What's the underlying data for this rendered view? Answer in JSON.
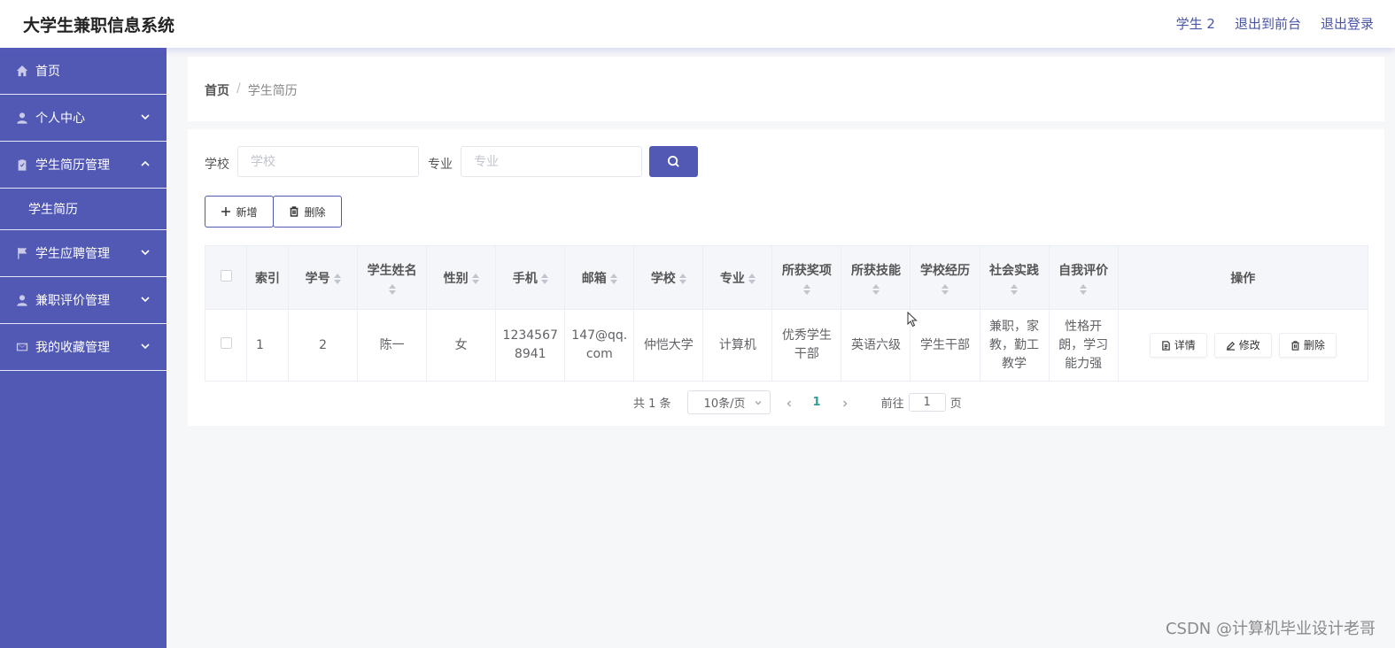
{
  "app": {
    "title": "大学生兼职信息系统"
  },
  "topbar": {
    "user": "学生 2",
    "to_front": "退出到前台",
    "logout": "退出登录"
  },
  "sidebar": {
    "items": [
      {
        "label": "首页",
        "icon": "home-icon"
      },
      {
        "label": "个人中心",
        "icon": "user-icon"
      },
      {
        "label": "学生简历管理",
        "icon": "clipboard-icon",
        "expanded": true,
        "sub": "学生简历"
      },
      {
        "label": "学生应聘管理",
        "icon": "flag-icon"
      },
      {
        "label": "兼职评价管理",
        "icon": "user-icon"
      },
      {
        "label": "我的收藏管理",
        "icon": "mail-icon"
      }
    ]
  },
  "breadcrumb": {
    "home": "首页",
    "sep": "/",
    "current": "学生简历"
  },
  "filters": {
    "school_label": "学校",
    "school_placeholder": "学校",
    "major_label": "专业",
    "major_placeholder": "专业"
  },
  "actions": {
    "add": "新增",
    "delete": "删除"
  },
  "table": {
    "headers": [
      "索引",
      "学号",
      "学生姓名",
      "性别",
      "手机",
      "邮箱",
      "学校",
      "专业",
      "所获奖项",
      "所获技能",
      "学校经历",
      "社会实践",
      "自我评价",
      "操作"
    ],
    "rows": [
      {
        "index": "1",
        "student_no": "2",
        "name": "陈一",
        "gender": "女",
        "phone": "12345678941",
        "email": "147@qq.com",
        "school": "仲恺大学",
        "major": "计算机",
        "awards": "优秀学生干部",
        "skills": "英语六级",
        "experience": "学生干部",
        "practice": "兼职，家教，勤工教学",
        "evaluation": "性格开朗，学习能力强"
      }
    ],
    "op_detail": "详情",
    "op_edit": "修改",
    "op_delete": "删除"
  },
  "pagination": {
    "total": "共 1 条",
    "page_size": "10条/页",
    "current_page": "1",
    "goto_prefix": "前往",
    "goto_value": "1",
    "goto_suffix": "页"
  },
  "watermark": "CSDN @计算机毕业设计老哥",
  "colors": {
    "primary": "#5259b5",
    "page_active": "#2aa198"
  }
}
